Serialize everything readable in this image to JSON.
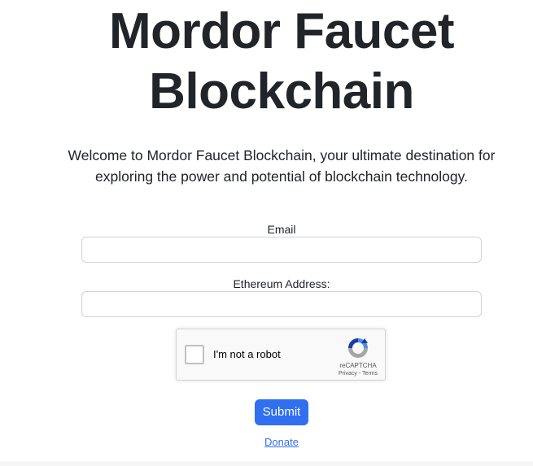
{
  "header": {
    "title": "Mordor Faucet Blockchain",
    "intro": "Welcome to Mordor Faucet Blockchain, your ultimate destination for exploring the power and potential of blockchain technology."
  },
  "form": {
    "email_label": "Email",
    "email_value": "",
    "address_label": "Ethereum Address:",
    "address_value": "",
    "submit_label": "Submit"
  },
  "captcha": {
    "checkbox_label": "I'm not a robot",
    "brand": "reCAPTCHA",
    "privacy_link": "Privacy",
    "separator": " - ",
    "terms_link": "Terms",
    "checked": false,
    "logo_icon": "recaptcha-logo-icon"
  },
  "footer": {
    "donate_label": "Donate"
  },
  "colors": {
    "primary": "#2f6ff0",
    "text": "#212529",
    "input_border": "#ced4da",
    "captcha_bg": "#f9f9f9"
  }
}
